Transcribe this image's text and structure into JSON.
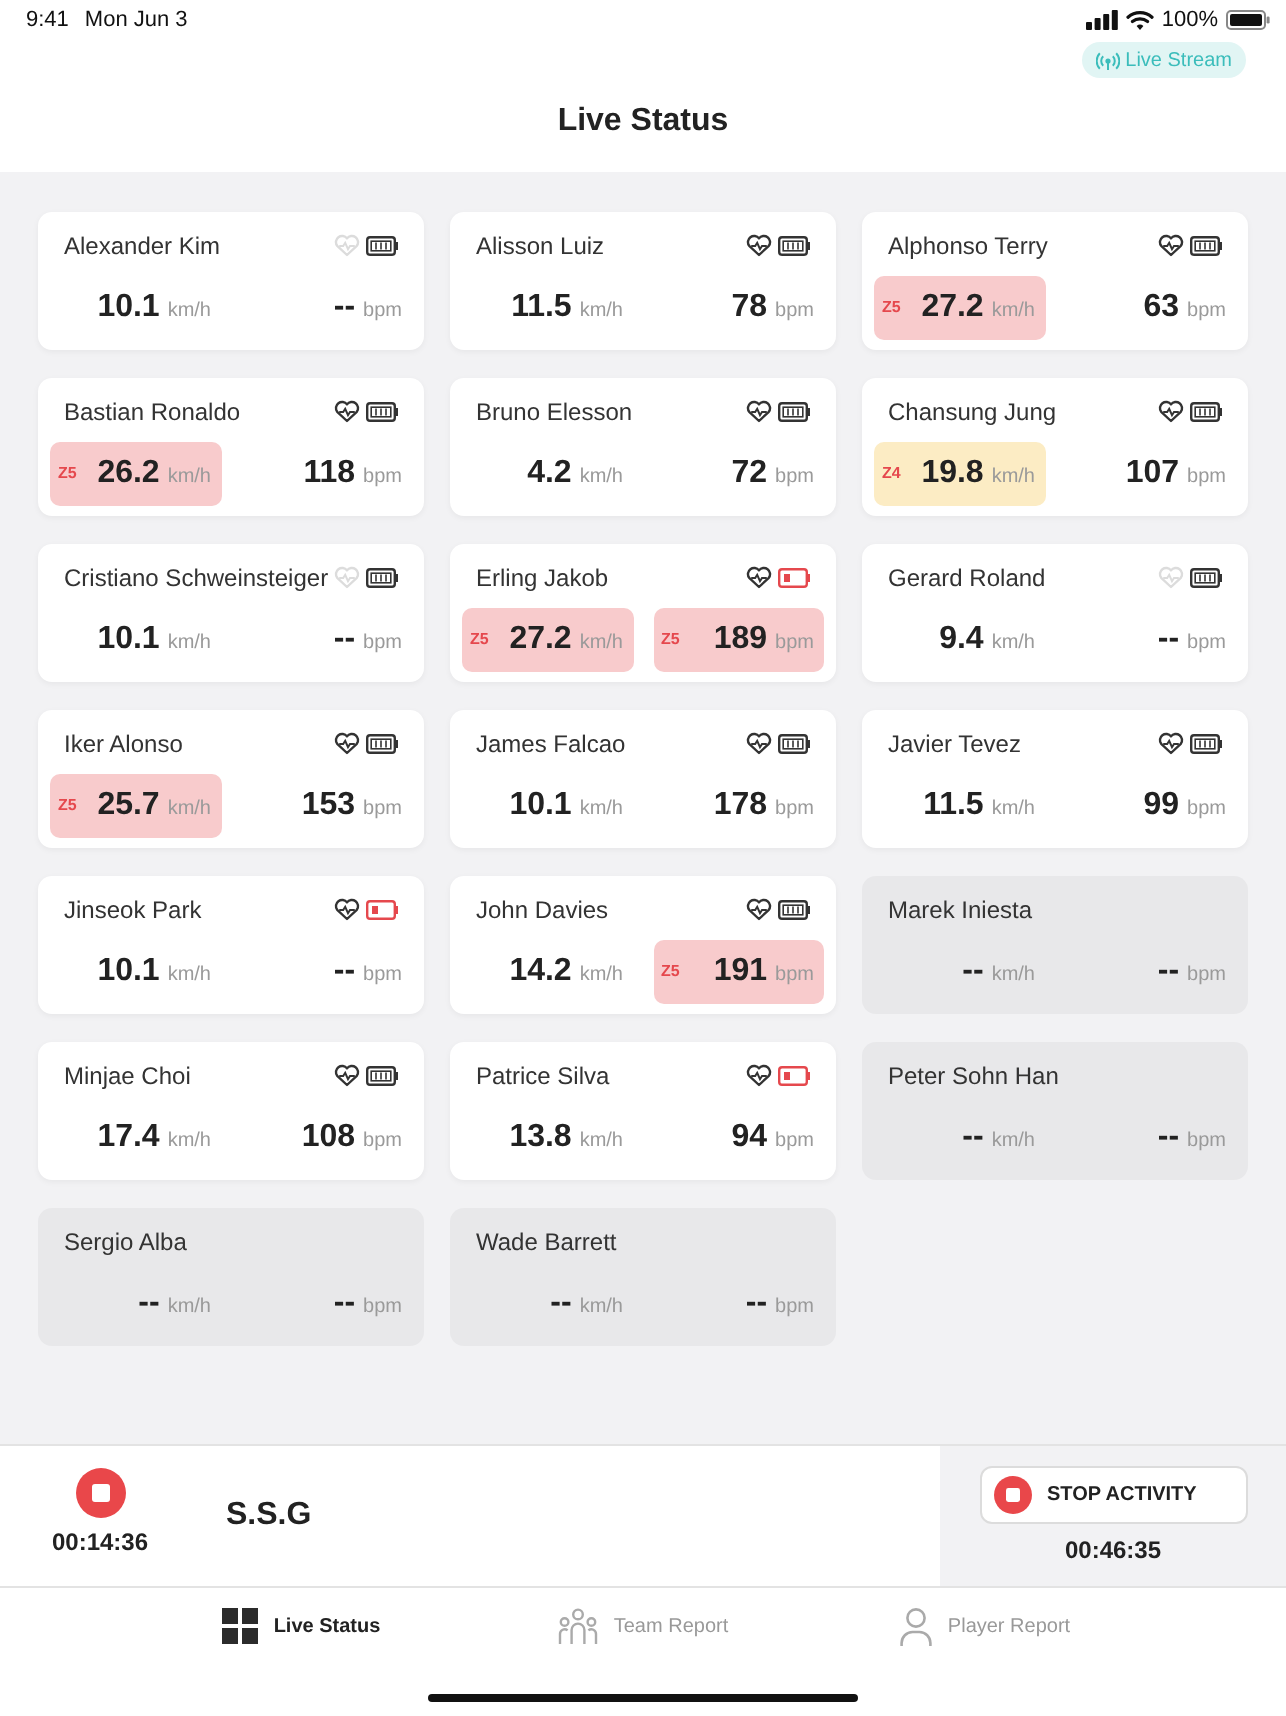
{
  "status_bar": {
    "time": "9:41",
    "date": "Mon Jun 3",
    "battery": "100%"
  },
  "live_stream_button": {
    "label": "Live Stream"
  },
  "title": "Live Status",
  "players": [
    {
      "name": "Alexander Kim",
      "kind": "active",
      "heart_connected": false,
      "battery_low": false,
      "speed": {
        "value": "10.1",
        "unit": "km/h"
      },
      "heart_rate": {
        "value": "--",
        "unit": "bpm"
      }
    },
    {
      "name": "Alisson Luiz",
      "kind": "active",
      "heart_connected": true,
      "battery_low": false,
      "speed": {
        "value": "11.5",
        "unit": "km/h"
      },
      "heart_rate": {
        "value": "78",
        "unit": "bpm"
      }
    },
    {
      "name": "Alphonso Terry",
      "kind": "active",
      "heart_connected": true,
      "battery_low": false,
      "speed": {
        "value": "27.2",
        "unit": "km/h",
        "zone": {
          "label": "Z5",
          "color": "#f8cbcc"
        }
      },
      "heart_rate": {
        "value": "63",
        "unit": "bpm"
      }
    },
    {
      "name": "Bastian Ronaldo",
      "kind": "active",
      "heart_connected": true,
      "battery_low": false,
      "speed": {
        "value": "26.2",
        "unit": "km/h",
        "zone": {
          "label": "Z5",
          "color": "#f8cbcc"
        }
      },
      "heart_rate": {
        "value": "118",
        "unit": "bpm"
      }
    },
    {
      "name": "Bruno Elesson",
      "kind": "active",
      "heart_connected": true,
      "battery_low": false,
      "speed": {
        "value": "4.2",
        "unit": "km/h"
      },
      "heart_rate": {
        "value": "72",
        "unit": "bpm"
      }
    },
    {
      "name": "Chansung Jung",
      "kind": "active",
      "heart_connected": true,
      "battery_low": false,
      "speed": {
        "value": "19.8",
        "unit": "km/h",
        "zone": {
          "label": "Z4",
          "color": "#fcecc4"
        }
      },
      "heart_rate": {
        "value": "107",
        "unit": "bpm"
      }
    },
    {
      "name": "Cristiano Schweinsteiger",
      "kind": "active",
      "heart_connected": false,
      "battery_low": false,
      "speed": {
        "value": "10.1",
        "unit": "km/h"
      },
      "heart_rate": {
        "value": "--",
        "unit": "bpm"
      }
    },
    {
      "name": "Erling Jakob",
      "kind": "active",
      "heart_connected": true,
      "battery_low": true,
      "speed": {
        "value": "27.2",
        "unit": "km/h",
        "zone": {
          "label": "Z5",
          "color": "#f8cbcc"
        }
      },
      "heart_rate": {
        "value": "189",
        "unit": "bpm",
        "zone": {
          "label": "Z5",
          "color": "#f8cbcc"
        }
      }
    },
    {
      "name": "Gerard Roland",
      "kind": "active",
      "heart_connected": false,
      "battery_low": false,
      "speed": {
        "value": "9.4",
        "unit": "km/h"
      },
      "heart_rate": {
        "value": "--",
        "unit": "bpm"
      }
    },
    {
      "name": "Iker Alonso",
      "kind": "active",
      "heart_connected": true,
      "battery_low": false,
      "speed": {
        "value": "25.7",
        "unit": "km/h",
        "zone": {
          "label": "Z5",
          "color": "#f8cbcc"
        }
      },
      "heart_rate": {
        "value": "153",
        "unit": "bpm"
      }
    },
    {
      "name": "James Falcao",
      "kind": "active",
      "heart_connected": true,
      "battery_low": false,
      "speed": {
        "value": "10.1",
        "unit": "km/h"
      },
      "heart_rate": {
        "value": "178",
        "unit": "bpm"
      }
    },
    {
      "name": "Javier Tevez",
      "kind": "active",
      "heart_connected": true,
      "battery_low": false,
      "speed": {
        "value": "11.5",
        "unit": "km/h"
      },
      "heart_rate": {
        "value": "99",
        "unit": "bpm"
      }
    },
    {
      "name": "Jinseok Park",
      "kind": "active",
      "heart_connected": true,
      "battery_low": true,
      "speed": {
        "value": "10.1",
        "unit": "km/h"
      },
      "heart_rate": {
        "value": "--",
        "unit": "bpm"
      }
    },
    {
      "name": "John Davies",
      "kind": "active",
      "heart_connected": true,
      "battery_low": false,
      "speed": {
        "value": "14.2",
        "unit": "km/h"
      },
      "heart_rate": {
        "value": "191",
        "unit": "bpm",
        "zone": {
          "label": "Z5",
          "color": "#f8cbcc"
        }
      }
    },
    {
      "name": "Marek Iniesta",
      "kind": "inactive",
      "speed": {
        "value": "--",
        "unit": "km/h"
      },
      "heart_rate": {
        "value": "--",
        "unit": "bpm"
      }
    },
    {
      "name": "Minjae Choi",
      "kind": "active",
      "heart_connected": true,
      "battery_low": false,
      "speed": {
        "value": "17.4",
        "unit": "km/h"
      },
      "heart_rate": {
        "value": "108",
        "unit": "bpm"
      }
    },
    {
      "name": "Patrice Silva",
      "kind": "active",
      "heart_connected": true,
      "battery_low": true,
      "speed": {
        "value": "13.8",
        "unit": "km/h"
      },
      "heart_rate": {
        "value": "94",
        "unit": "bpm"
      }
    },
    {
      "name": "Peter Sohn Han",
      "kind": "inactive",
      "speed": {
        "value": "--",
        "unit": "km/h"
      },
      "heart_rate": {
        "value": "--",
        "unit": "bpm"
      }
    },
    {
      "name": "Sergio Alba",
      "kind": "inactive",
      "speed": {
        "value": "--",
        "unit": "km/h"
      },
      "heart_rate": {
        "value": "--",
        "unit": "bpm"
      }
    },
    {
      "name": "Wade Barrett",
      "kind": "inactive",
      "speed": {
        "value": "--",
        "unit": "km/h"
      },
      "heart_rate": {
        "value": "--",
        "unit": "bpm"
      }
    }
  ],
  "activity_bar": {
    "elapsed": "00:14:36",
    "name": "S.S.G",
    "stop_button": "STOP ACTIVITY",
    "total": "00:46:35"
  },
  "tabs": [
    {
      "label": "Live Status",
      "selected": true
    },
    {
      "label": "Team Report",
      "selected": false
    },
    {
      "label": "Player Report",
      "selected": false
    }
  ]
}
